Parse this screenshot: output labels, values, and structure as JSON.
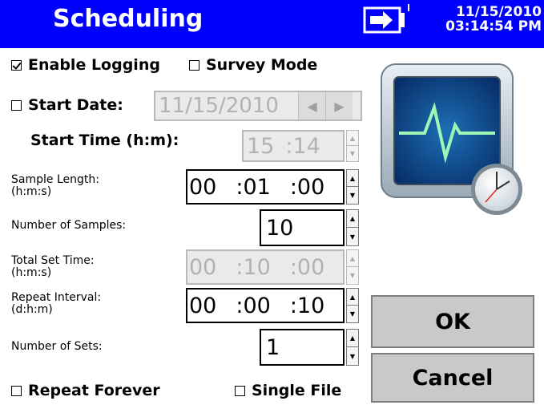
{
  "header": {
    "title": "Scheduling",
    "date": "11/15/2010",
    "time": "03:14:54 PM",
    "battery_icon": "battery-plug-icon",
    "bar_color": "#0000ff"
  },
  "options": {
    "enable_logging": {
      "label": "Enable Logging",
      "checked": true
    },
    "survey_mode": {
      "label": "Survey Mode",
      "checked": false
    },
    "start_date": {
      "label": "Start Date:",
      "checked": false,
      "value": "11/15/2010"
    },
    "repeat_forever": {
      "label": "Repeat Forever",
      "checked": false
    },
    "single_file": {
      "label": "Single File",
      "checked": false
    }
  },
  "fields": {
    "start_time": {
      "label": "Start Time (h:m):",
      "h": "15",
      "m": ":14"
    },
    "sample_length": {
      "label_line1": "Sample Length:",
      "label_line2": "(h:m:s)",
      "h": "00",
      "m": ":01",
      "s": ":00"
    },
    "num_samples": {
      "label": "Number of Samples:",
      "value": "10"
    },
    "total_set_time": {
      "label_line1": "Total Set Time:",
      "label_line2": "(h:m:s)",
      "h": "00",
      "m": ":10",
      "s": ":00"
    },
    "repeat_interval": {
      "label_line1": "Repeat Interval:",
      "label_line2": "(d:h:m)",
      "d": "00",
      "h": ":00",
      "m": ":10"
    },
    "num_sets": {
      "label": "Number of Sets:",
      "value": "1"
    }
  },
  "buttons": {
    "ok": "OK",
    "cancel": "Cancel"
  },
  "icons": {
    "monitor": "monitor-clock-icon"
  }
}
